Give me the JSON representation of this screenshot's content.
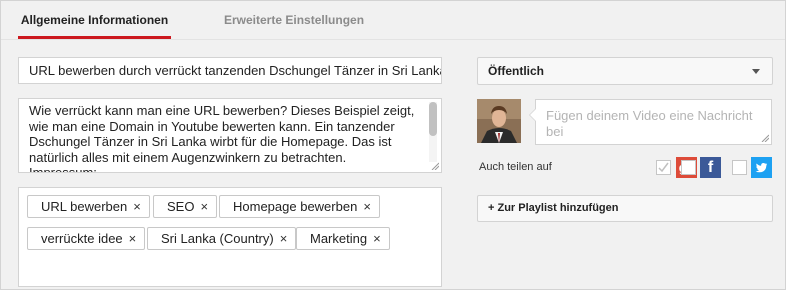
{
  "tabs": {
    "general": "Allgemeine Informationen",
    "advanced": "Erweiterte Einstellungen"
  },
  "title_input": {
    "value": "URL bewerben durch verrückt tanzenden Dschungel Tänzer  in Sri Lanka"
  },
  "description": {
    "lines": [
      "Wie verrückt kann man eine URL bewerben? Dieses Beispiel zeigt,",
      "wie man eine Domain in Youtube bewerten kann. Ein tanzender",
      "Dschungel Tänzer in Sri Lanka wirbt für die Homepage. Das ist",
      "natürlich alles mit einem Augenzwinkern zu betrachten.",
      "Impressum:"
    ]
  },
  "tags": [
    {
      "label": "URL bewerben",
      "remove": "×"
    },
    {
      "label": "SEO",
      "remove": "×"
    },
    {
      "label": "Homepage bewerben",
      "remove": "×"
    },
    {
      "label": "verrückte idee",
      "remove": "×"
    },
    {
      "label": "Sri Lanka (Country)",
      "remove": "×"
    },
    {
      "label": "Marketing",
      "remove": "×"
    }
  ],
  "privacy": {
    "selected": "Öffentlich"
  },
  "message": {
    "placeholder": "Fügen deinem Video eine Nachricht bei"
  },
  "share": {
    "label": "Auch teilen auf",
    "google_plus": "g+",
    "facebook": "f",
    "twitter_icon": "twitter-bird"
  },
  "playlist": {
    "button": "+ Zur Playlist hinzufügen"
  },
  "colors": {
    "accent": "#cc181e",
    "google_plus": "#dd4b39",
    "facebook": "#3b5998",
    "twitter": "#1da1f2"
  }
}
